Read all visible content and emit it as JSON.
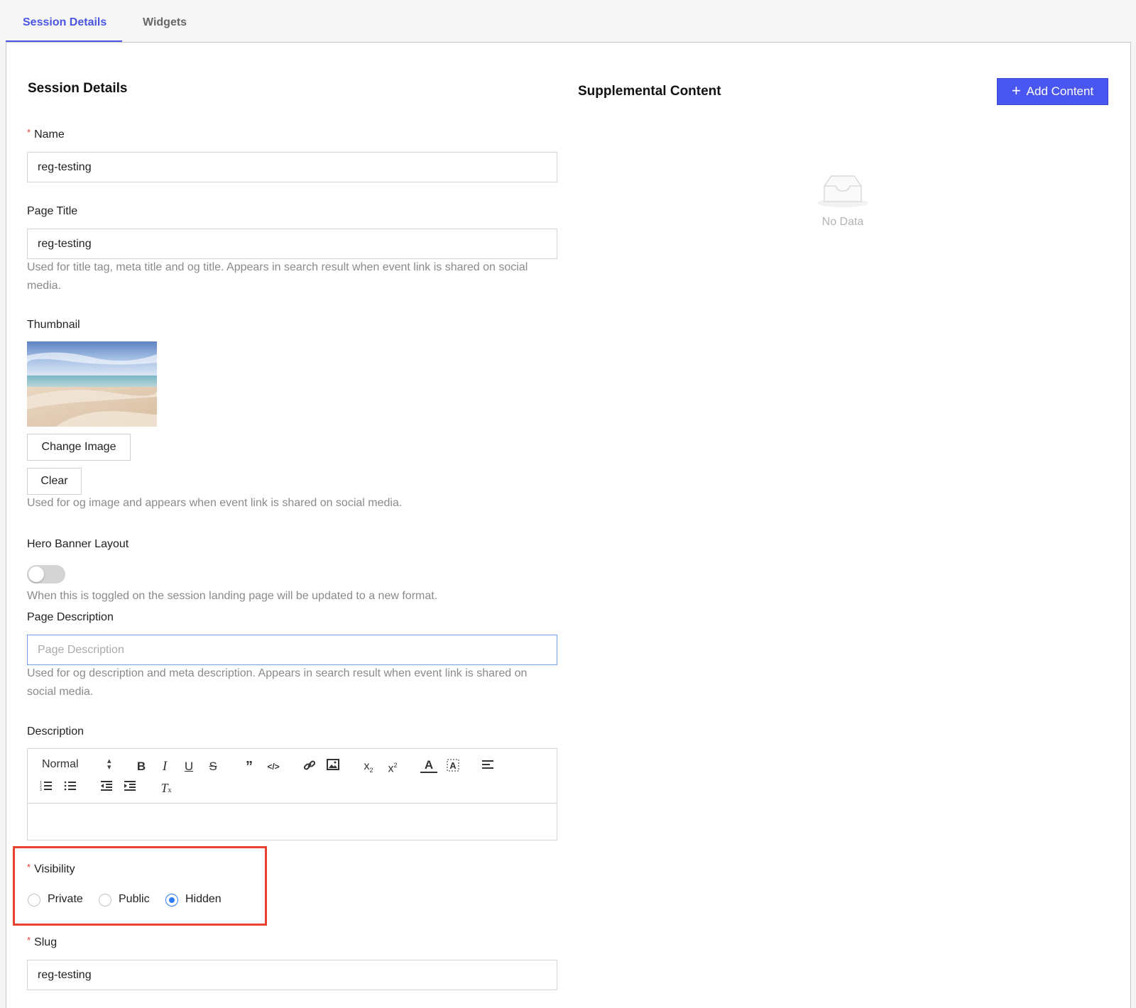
{
  "tabs": [
    {
      "label": "Session Details",
      "active": true
    },
    {
      "label": "Widgets",
      "active": false
    }
  ],
  "left": {
    "section_title": "Session Details",
    "name": {
      "label": "Name",
      "value": "reg-testing",
      "required": true
    },
    "page_title": {
      "label": "Page Title",
      "value": "reg-testing",
      "help_line1": "Used for title tag, meta title and og title. Appears in search result when event link is shared on social",
      "help_line2": "media."
    },
    "thumbnail": {
      "label": "Thumbnail",
      "change_button": "Change Image",
      "clear_button": "Clear",
      "help": "Used for og image and appears when event link is shared on social media."
    },
    "hero_banner": {
      "label": "Hero Banner Layout",
      "enabled": false,
      "help": "When this is toggled on the session landing page will be updated to a new format."
    },
    "page_description": {
      "label": "Page Description",
      "placeholder": "Page Description",
      "value": "",
      "help_line1": "Used for og description and meta description. Appears in search result when event link is shared on",
      "help_line2": "social media."
    },
    "description": {
      "label": "Description",
      "format_select": "Normal",
      "tools": [
        "bold-icon",
        "italic-icon",
        "underline-icon",
        "strikethrough-icon",
        "blockquote-icon",
        "code-icon",
        "link-icon",
        "image-icon",
        "subscript-icon",
        "superscript-icon",
        "font-color-icon",
        "background-color-icon",
        "align-icon",
        "ordered-list-icon",
        "bullet-list-icon",
        "outdent-icon",
        "indent-icon",
        "clear-format-icon"
      ]
    },
    "visibility": {
      "label": "Visibility",
      "required": true,
      "options": [
        "Private",
        "Public",
        "Hidden"
      ],
      "selected": "Hidden"
    },
    "slug": {
      "label": "Slug",
      "value": "reg-testing",
      "required": true
    }
  },
  "right": {
    "section_title": "Supplemental Content",
    "add_button": "Add Content",
    "empty_text": "No Data"
  },
  "colors": {
    "accent": "#4a56e2",
    "primary_button": "#4a56f0",
    "required": "#e53935",
    "highlight_box": "#e8412f",
    "radio_checked": "#2f7cf6"
  }
}
